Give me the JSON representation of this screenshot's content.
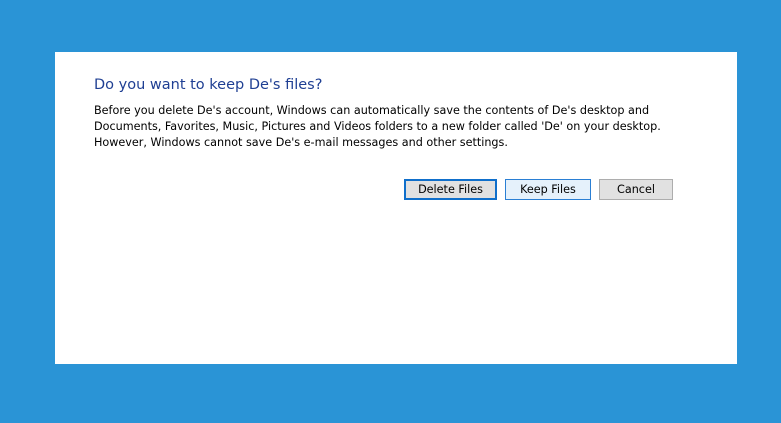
{
  "dialog": {
    "title": "Do you want to keep De's files?",
    "message_lines": [
      "Before you delete De's account, Windows can automatically save the contents of De's desktop and",
      "Documents, Favorites, Music, Pictures and Videos folders to a new folder called 'De' on your desktop.",
      "However, Windows cannot save De's e-mail messages and other settings."
    ],
    "buttons": {
      "delete_files": "Delete Files",
      "keep_files": "Keep Files",
      "cancel": "Cancel"
    }
  },
  "colors": {
    "desktop_background": "#2a94d6",
    "title_text": "#1f3f93",
    "focus_border": "#0f6fcb"
  }
}
